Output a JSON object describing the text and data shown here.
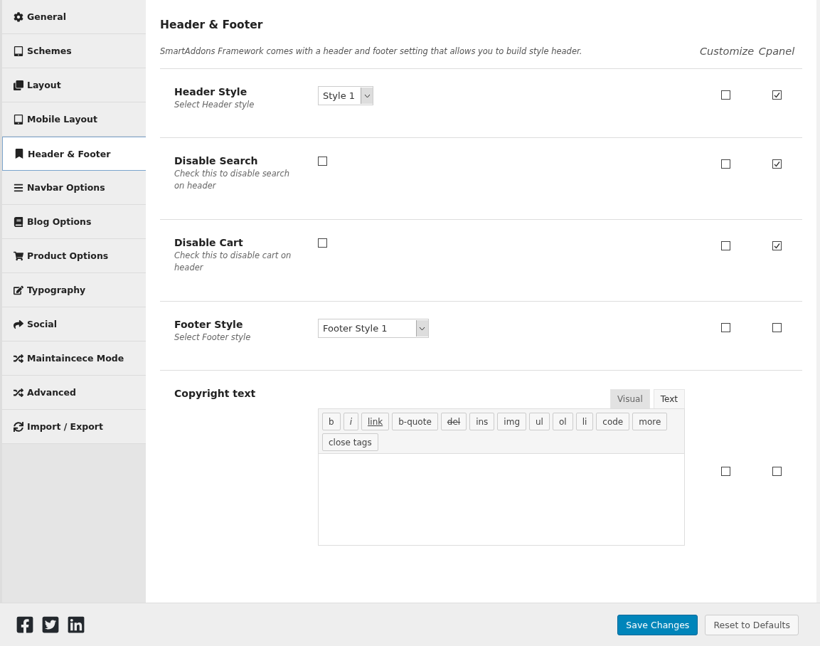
{
  "sidebar": {
    "items": [
      {
        "label": "General",
        "selected": false
      },
      {
        "label": "Schemes",
        "selected": false
      },
      {
        "label": "Layout",
        "selected": false
      },
      {
        "label": "Mobile Layout",
        "selected": false
      },
      {
        "label": "Header & Footer",
        "selected": true
      },
      {
        "label": "Navbar Options",
        "selected": false
      },
      {
        "label": "Blog Options",
        "selected": false
      },
      {
        "label": "Product Options",
        "selected": false
      },
      {
        "label": "Typography",
        "selected": false
      },
      {
        "label": "Social",
        "selected": false
      },
      {
        "label": "Maintaincece Mode",
        "selected": false
      },
      {
        "label": "Advanced",
        "selected": false
      },
      {
        "label": "Import / Export",
        "selected": false
      }
    ]
  },
  "section": {
    "title": "Header & Footer",
    "description": "SmartAddons Framework comes with a header and footer setting that allows you to build style header.",
    "columns": [
      "Customize",
      "Cpanel"
    ]
  },
  "options": [
    {
      "kind": "select",
      "title": "Header Style",
      "hint": "Select Header style",
      "value": "Style 1",
      "customize": false,
      "cpanel": true
    },
    {
      "kind": "checkbox",
      "title": "Disable Search",
      "hint": "Check this to disable search on header",
      "checked": false,
      "customize": false,
      "cpanel": true
    },
    {
      "kind": "checkbox",
      "title": "Disable Cart",
      "hint": "Check this to disable cart on header",
      "checked": false,
      "customize": false,
      "cpanel": true
    },
    {
      "kind": "select",
      "title": "Footer Style",
      "hint": "Select Footer style",
      "value": "Footer Style 1",
      "customize": false,
      "cpanel": false
    },
    {
      "kind": "editor",
      "title": "Copyright text",
      "tabs": [
        {
          "label": "Visual",
          "selected": false
        },
        {
          "label": "Text",
          "selected": true
        }
      ],
      "buttons": [
        "b",
        "i",
        "link",
        "b-quote",
        "del",
        "ins",
        "img",
        "ul",
        "ol",
        "li",
        "code",
        "more",
        "close tags"
      ],
      "customize": false,
      "cpanel": false
    }
  ],
  "footer": {
    "buttons": [
      {
        "label": "Save Changes",
        "kind": "primary"
      },
      {
        "label": "Reset to Defaults",
        "kind": "secondary"
      }
    ]
  }
}
